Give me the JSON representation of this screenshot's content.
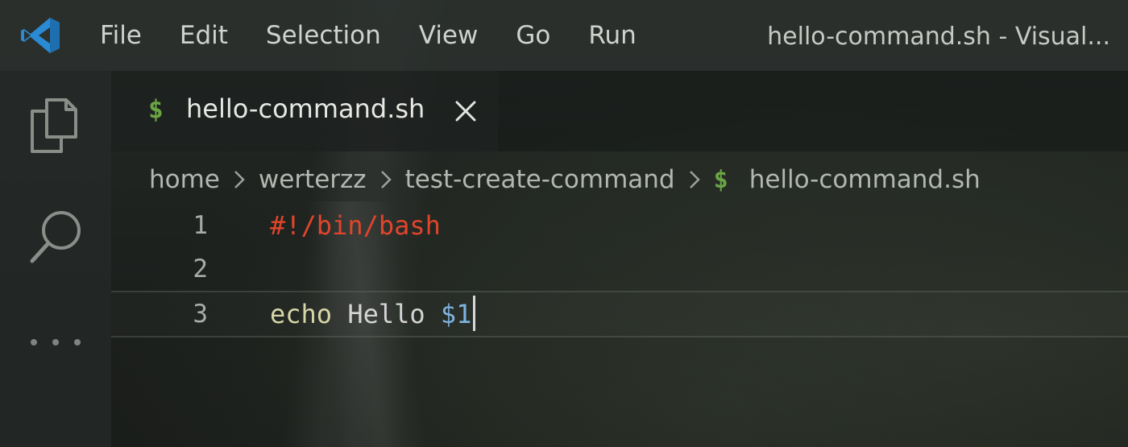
{
  "titlebar": {
    "app_icon": "vscode-logo-icon",
    "menu": [
      "File",
      "Edit",
      "Selection",
      "View",
      "Go",
      "Run"
    ],
    "window_title": "hello-command.sh - Visual..."
  },
  "activitybar": {
    "items": [
      "explorer-icon",
      "search-icon",
      "more-icon"
    ]
  },
  "tabs": [
    {
      "icon": "$",
      "label": "hello-command.sh",
      "close_icon": "close-icon",
      "active": true
    }
  ],
  "breadcrumb": {
    "items": [
      "home",
      "werterzz",
      "test-create-command",
      "hello-command.sh"
    ],
    "file_icon": "$"
  },
  "editor": {
    "lines": [
      {
        "number": "1",
        "tokens": [
          {
            "text": "#!/bin/bash",
            "kind": "shebang"
          }
        ]
      },
      {
        "number": "2",
        "tokens": []
      },
      {
        "number": "3",
        "tokens": [
          {
            "text": "echo",
            "kind": "cmd"
          },
          {
            "text": " Hello ",
            "kind": "text"
          },
          {
            "text": "$1",
            "kind": "var"
          }
        ]
      }
    ],
    "current_line": 3
  },
  "colors": {
    "shell_icon": "#6aa545",
    "shebang": "#e0452b",
    "command": "#d6d6a8",
    "variable": "#7fb3e0",
    "vscode_blue": "#2a8ad4"
  }
}
